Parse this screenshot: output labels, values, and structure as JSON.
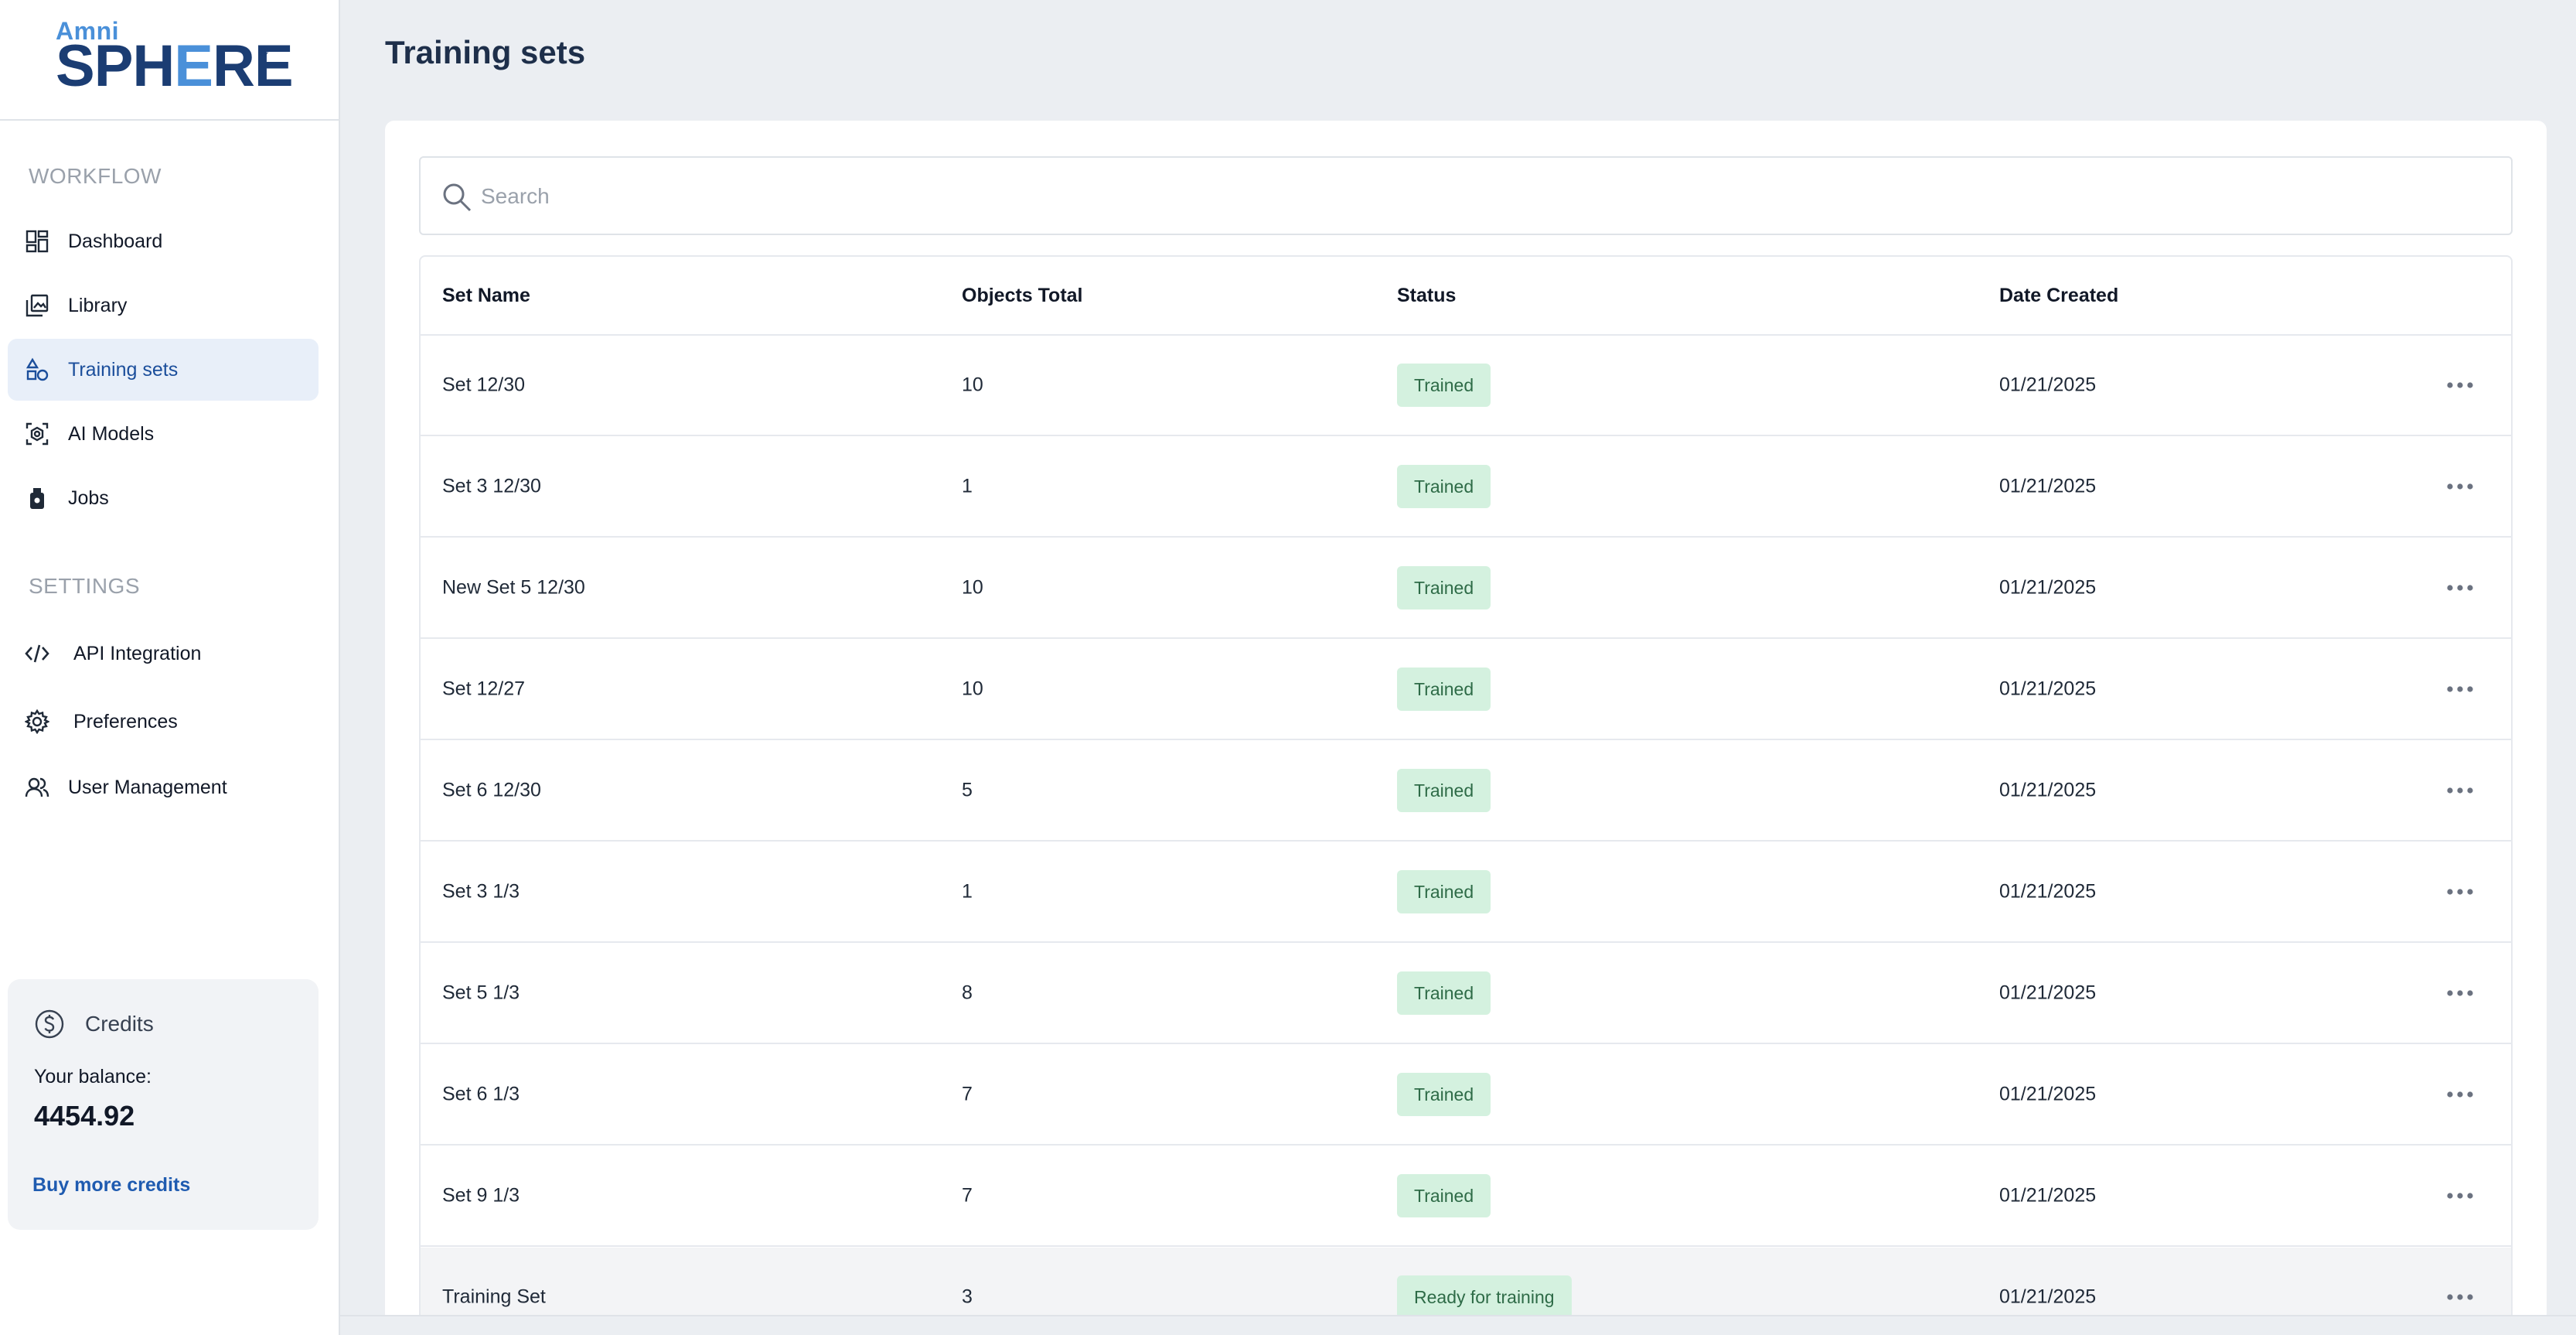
{
  "brand": {
    "top": "Amni",
    "main_pre": "SPH",
    "main_mark": "E",
    "main_post": "RE",
    "reg": "®"
  },
  "sidebar": {
    "workflow_title": "WORKFLOW",
    "workflow_items": [
      {
        "label": "Dashboard",
        "icon": "dashboard-icon"
      },
      {
        "label": "Library",
        "icon": "library-icon"
      },
      {
        "label": "Training sets",
        "icon": "shapes-icon",
        "active": true
      },
      {
        "label": "AI Models",
        "icon": "ai-model-icon"
      },
      {
        "label": "Jobs",
        "icon": "jobs-icon"
      }
    ],
    "settings_title": "SETTINGS",
    "settings_items": [
      {
        "label": "API Integration",
        "icon": "code-icon"
      },
      {
        "label": "Preferences",
        "icon": "gear-icon"
      },
      {
        "label": "User Management",
        "icon": "users-icon"
      }
    ]
  },
  "credits": {
    "title": "Credits",
    "icon": "dollar-circle-icon",
    "balance_label": "Your balance:",
    "balance": "4454.92",
    "buy_label": "Buy more credits"
  },
  "main": {
    "title": "Training sets",
    "search": {
      "placeholder": "Search",
      "value": ""
    },
    "table": {
      "columns": [
        "Set Name",
        "Objects Total",
        "Status",
        "Date Created"
      ],
      "rows": [
        {
          "name": "Set 12/30",
          "objects": "10",
          "status": "Trained",
          "date": "01/21/2025"
        },
        {
          "name": "Set 3 12/30",
          "objects": "1",
          "status": "Trained",
          "date": "01/21/2025"
        },
        {
          "name": "New Set 5 12/30",
          "objects": "10",
          "status": "Trained",
          "date": "01/21/2025"
        },
        {
          "name": "Set 12/27",
          "objects": "10",
          "status": "Trained",
          "date": "01/21/2025"
        },
        {
          "name": "Set 6 12/30",
          "objects": "5",
          "status": "Trained",
          "date": "01/21/2025"
        },
        {
          "name": "Set 3 1/3",
          "objects": "1",
          "status": "Trained",
          "date": "01/21/2025"
        },
        {
          "name": "Set 5 1/3",
          "objects": "8",
          "status": "Trained",
          "date": "01/21/2025"
        },
        {
          "name": "Set 6 1/3",
          "objects": "7",
          "status": "Trained",
          "date": "01/21/2025"
        },
        {
          "name": "Set 9 1/3",
          "objects": "7",
          "status": "Trained",
          "date": "01/21/2025"
        },
        {
          "name": "Training Set",
          "objects": "3",
          "status": "Ready for training",
          "date": "01/21/2025"
        }
      ]
    }
  },
  "colors": {
    "accent": "#1b4e9b",
    "active_nav_bg": "#e8eff9",
    "status_badge_bg": "#d4f1df",
    "status_badge_text": "#2e6b47",
    "page_bg": "#ebeef2"
  }
}
